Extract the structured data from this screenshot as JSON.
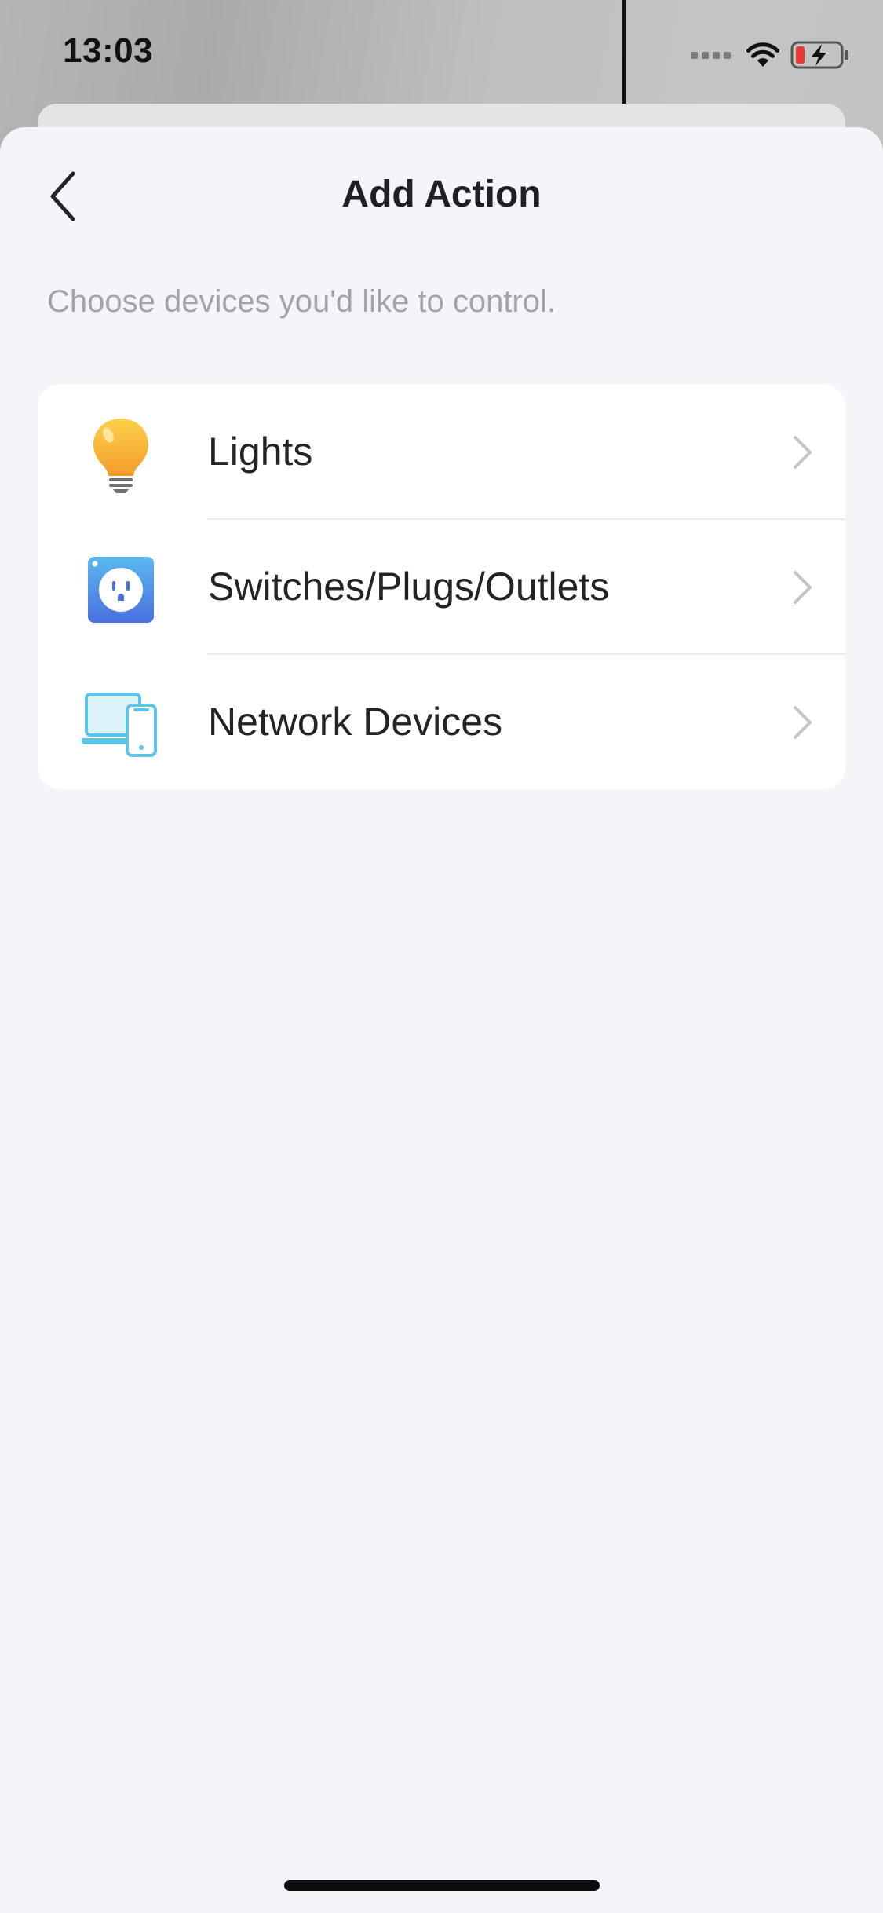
{
  "status_bar": {
    "time": "13:03",
    "icons": [
      "signal-dots-icon",
      "wifi-icon",
      "battery-charging-icon"
    ],
    "battery_color": "#e53935"
  },
  "header": {
    "title": "Add Action",
    "back_icon": "chevron-left-icon"
  },
  "subtitle": "Choose devices you'd like to control.",
  "device_categories": [
    {
      "label": "Lights",
      "icon": "light-bulb-icon",
      "accent": "#f6b93b"
    },
    {
      "label": "Switches/Plugs/Outlets",
      "icon": "smart-plug-icon",
      "accent": "#4f86e8"
    },
    {
      "label": "Network Devices",
      "icon": "network-devices-icon",
      "accent": "#5ec4e8"
    }
  ],
  "colors": {
    "sheet_background": "#f3f5f9",
    "card_background": "#ffffff",
    "text_primary": "#222427",
    "text_secondary": "#a1a4a8",
    "chevron": "#c3c5c8"
  }
}
